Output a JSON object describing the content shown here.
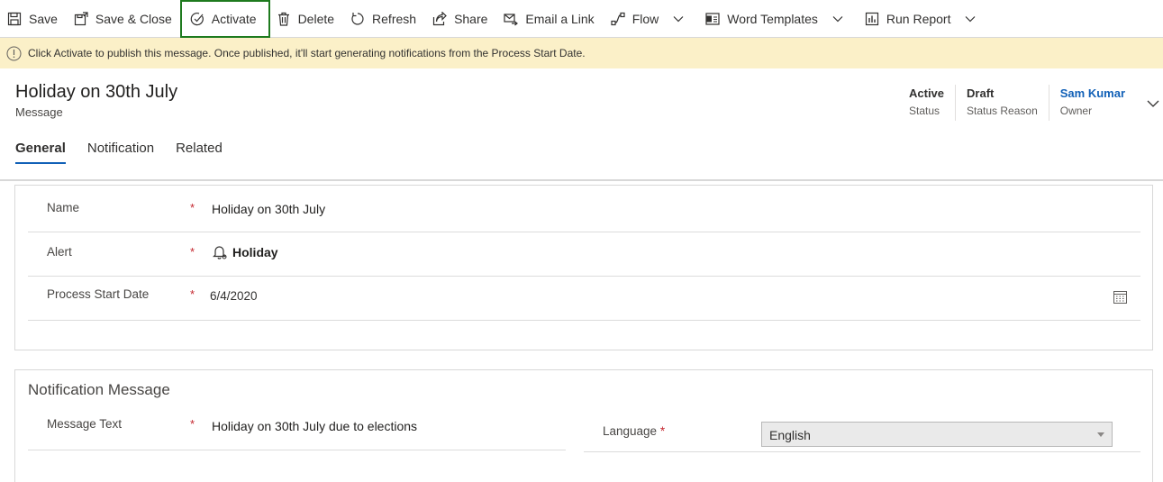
{
  "toolbar": {
    "save": "Save",
    "save_close": "Save & Close",
    "activate": "Activate",
    "delete": "Delete",
    "refresh": "Refresh",
    "share": "Share",
    "email_link": "Email a Link",
    "flow": "Flow",
    "word_templates": "Word Templates",
    "run_report": "Run Report"
  },
  "banner": {
    "text": "Click Activate to publish this message. Once published, it'll start generating notifications from the Process Start Date."
  },
  "header": {
    "title": "Holiday on 30th July",
    "entity": "Message",
    "fields": [
      {
        "value": "Active",
        "label": "Status"
      },
      {
        "value": "Draft",
        "label": "Status Reason"
      },
      {
        "value": "Sam Kumar",
        "label": "Owner"
      }
    ]
  },
  "tabs": [
    "General",
    "Notification",
    "Related"
  ],
  "general": {
    "name_label": "Name",
    "name_value": "Holiday on 30th July",
    "alert_label": "Alert",
    "alert_value": "Holiday",
    "start_label": "Process Start Date",
    "start_value": "6/4/2020",
    "required_mark": "*"
  },
  "notification_section": {
    "title": "Notification Message",
    "message_label": "Message Text",
    "message_value": "Holiday on 30th July due to elections",
    "language_label": "Language",
    "language_value": "English"
  },
  "colors": {
    "accent": "#1160b7",
    "banner_bg": "#fbf0c8",
    "required": "#c4262e",
    "highlight_outline": "#1e7a1e"
  }
}
